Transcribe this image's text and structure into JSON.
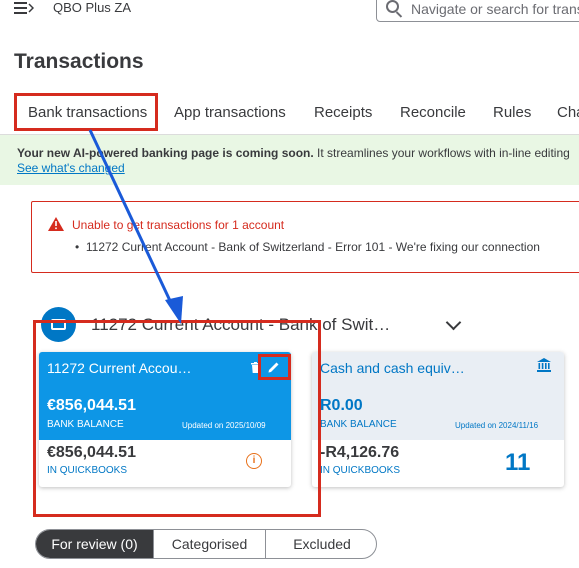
{
  "topbar": {
    "company": "QBO Plus ZA",
    "search_placeholder": "Navigate or search for transactions"
  },
  "page": {
    "title": "Transactions"
  },
  "tabs": [
    {
      "label": "Bank transactions",
      "active": true
    },
    {
      "label": "App transactions"
    },
    {
      "label": "Receipts"
    },
    {
      "label": "Reconcile"
    },
    {
      "label": "Rules"
    },
    {
      "label": "Chart of accounts"
    }
  ],
  "banner": {
    "bold": "Your new AI-powered banking page is coming soon.",
    "text": " It streamlines your workflows with in-line editing",
    "link": "See what's changed"
  },
  "error": {
    "title": "Unable to get transactions for 1 account",
    "bullet": "11272 Current Account - Bank of Switzerland - Error 101 - We're fixing our connection"
  },
  "account": {
    "title": "11272 Current Account - Bank of Swit…"
  },
  "cards": [
    {
      "name": "11272 Current Accou…",
      "bank_balance": "€856,044.51",
      "bank_balance_label": "BANK BALANCE",
      "updated": "Updated on 2025/10/09",
      "qb_balance": "€856,044.51",
      "qb_label": "IN QUICKBOOKS"
    },
    {
      "name": "Cash and cash equiv…",
      "bank_balance": "R0.00",
      "bank_balance_label": "BANK BALANCE",
      "updated": "Updated on 2024/11/16",
      "qb_balance": "-R4,126.76",
      "qb_label": "IN QUICKBOOKS",
      "count": "11"
    }
  ],
  "filter": {
    "for_review": "For review (0)",
    "categorised": "Categorised",
    "excluded": "Excluded"
  },
  "colors": {
    "accent_blue": "#0077c5",
    "card_blue": "#0d96e6",
    "highlight_red": "#d52b1e",
    "banner_green": "#e9f7e4"
  }
}
